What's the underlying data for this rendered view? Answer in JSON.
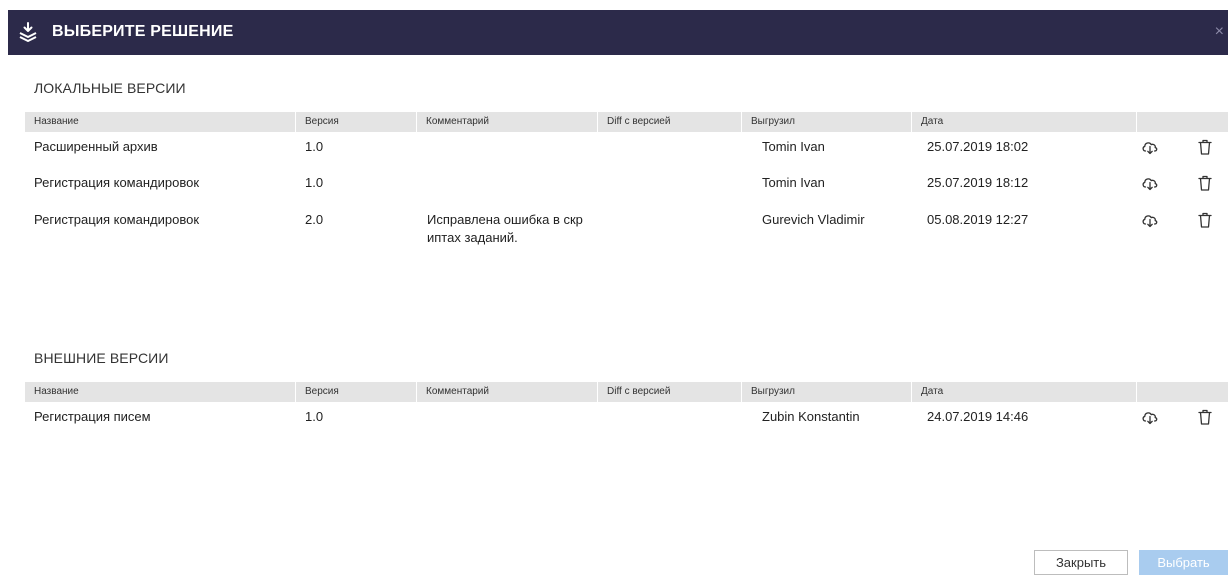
{
  "header": {
    "title": "ВЫБЕРИТЕ РЕШЕНИЕ",
    "close_label": "×",
    "logo_icon": "download-stack-icon",
    "background": "#2c2a4a"
  },
  "columns": {
    "name": "Название",
    "version": "Версия",
    "comment": "Комментарий",
    "diff": "Diff с версией",
    "uploaded_by": "Выгрузил",
    "date": "Дата"
  },
  "local": {
    "title": "ЛОКАЛЬНЫЕ ВЕРСИИ",
    "rows": [
      {
        "name": "Расширенный архив",
        "version": "1.0",
        "comment": "",
        "diff": "",
        "uploaded_by": "Tomin Ivan",
        "date": "25.07.2019 18:02"
      },
      {
        "name": "Регистрация командировок",
        "version": "1.0",
        "comment": "",
        "diff": "",
        "uploaded_by": "Tomin Ivan",
        "date": "25.07.2019 18:12"
      },
      {
        "name": "Регистрация командировок",
        "version": "2.0",
        "comment": "Исправлена ошибка в скр\nиптах заданий.",
        "diff": "",
        "uploaded_by": "Gurevich Vladimir",
        "date": "05.08.2019 12:27"
      }
    ]
  },
  "external": {
    "title": "ВНЕШНИЕ ВЕРСИИ",
    "rows": [
      {
        "name": "Регистрация писем",
        "version": "1.0",
        "comment": "",
        "diff": "",
        "uploaded_by": "Zubin Konstantin",
        "date": "24.07.2019 14:46"
      }
    ]
  },
  "row_icons": [
    "cloud-download-icon",
    "trash-icon"
  ],
  "footer": {
    "close_label": "Закрыть",
    "select_label": "Выбрать",
    "select_color": "#a9ccef"
  }
}
